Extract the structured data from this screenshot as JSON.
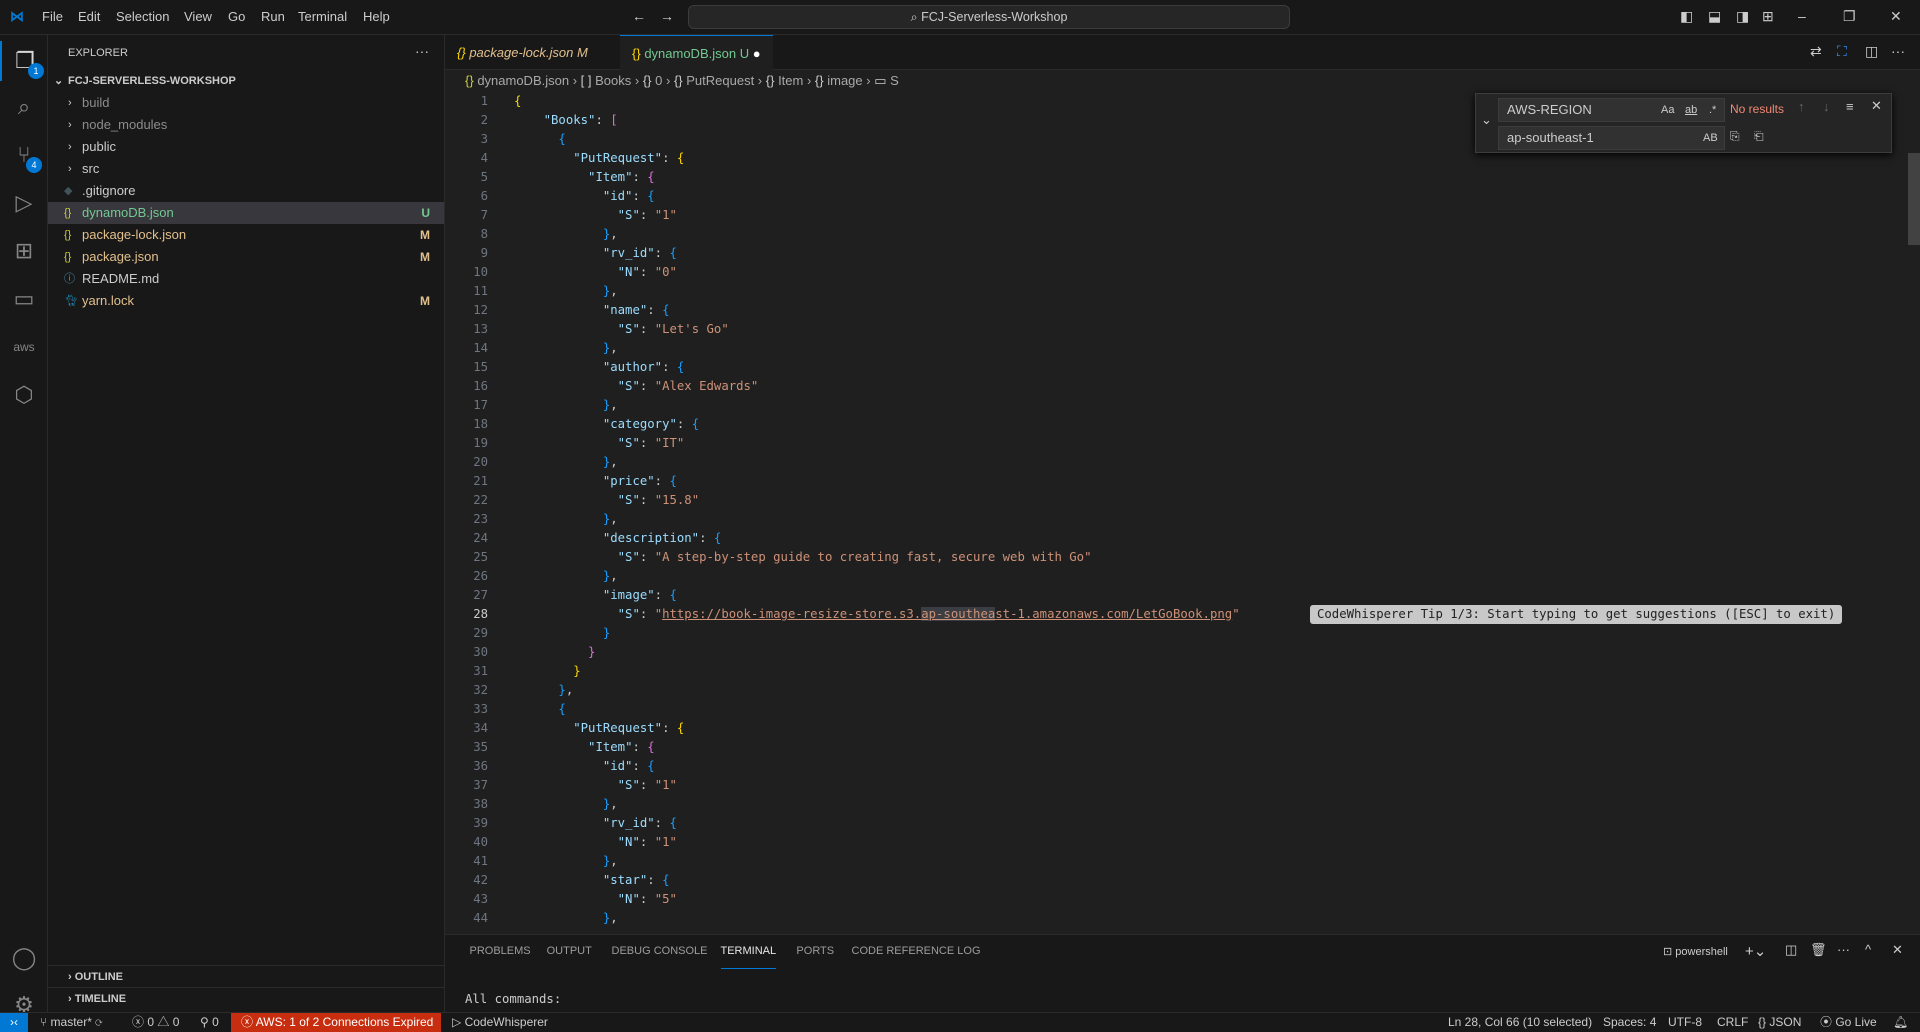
{
  "titlebar": {
    "menus": [
      "File",
      "Edit",
      "Selection",
      "View",
      "Go",
      "Run",
      "Terminal",
      "Help"
    ],
    "search": "FCJ-Serverless-Workshop"
  },
  "activity": {
    "explorer_badge": "1",
    "scm_badge": "4"
  },
  "explorer": {
    "title": "EXPLORER",
    "more": "···",
    "root": "FCJ-SERVERLESS-WORKSHOP",
    "items": [
      {
        "name": "build",
        "type": "folder",
        "status": ""
      },
      {
        "name": "node_modules",
        "type": "folder",
        "status": ""
      },
      {
        "name": "public",
        "type": "folder",
        "status": ""
      },
      {
        "name": "src",
        "type": "folder",
        "status": ""
      },
      {
        "name": ".gitignore",
        "type": "git",
        "status": ""
      },
      {
        "name": "dynamoDB.json",
        "type": "json",
        "status": "U"
      },
      {
        "name": "package-lock.json",
        "type": "json",
        "status": "M"
      },
      {
        "name": "package.json",
        "type": "json",
        "status": "M"
      },
      {
        "name": "README.md",
        "type": "info",
        "status": ""
      },
      {
        "name": "yarn.lock",
        "type": "yarn",
        "status": "M"
      }
    ],
    "outline": "OUTLINE",
    "timeline": "TIMELINE"
  },
  "tabs": [
    {
      "label": "package-lock.json",
      "status": "M"
    },
    {
      "label": "dynamoDB.json",
      "status": "U"
    }
  ],
  "breadcrumb": [
    "dynamoDB.json",
    "Books",
    "0",
    "PutRequest",
    "Item",
    "image",
    "S"
  ],
  "editor": {
    "current_line": 28,
    "selection": "ap-southea",
    "lines": [
      "{",
      "    \"Books\": [",
      "      {",
      "        \"PutRequest\": {",
      "          \"Item\": {",
      "            \"id\": {",
      "              \"S\": \"1\"",
      "            },",
      "            \"rv_id\": {",
      "              \"N\": \"0\"",
      "            },",
      "            \"name\": {",
      "              \"S\": \"Let's Go\"",
      "            },",
      "            \"author\": {",
      "              \"S\": \"Alex Edwards\"",
      "            },",
      "            \"category\": {",
      "              \"S\": \"IT\"",
      "            },",
      "            \"price\": {",
      "              \"S\": \"15.8\"",
      "            },",
      "            \"description\": {",
      "              \"S\": \"A step-by-step guide to creating fast, secure web with Go\"",
      "            },",
      "            \"image\": {",
      "              \"S\": \"https://book-image-resize-store.s3.ap-southeast-1.amazonaws.com/LetGoBook.png\"",
      "            }",
      "          }",
      "        }",
      "      },",
      "      {",
      "        \"PutRequest\": {",
      "          \"Item\": {",
      "            \"id\": {",
      "              \"S\": \"1\"",
      "            },",
      "            \"rv_id\": {",
      "              \"N\": \"1\"",
      "            },",
      "            \"star\": {",
      "              \"N\": \"5\"",
      "            },"
    ]
  },
  "find": {
    "search": "AWS-REGION",
    "replace": "ap-southeast-1",
    "result": "No results",
    "opt_case": "Aa",
    "opt_word": "ab",
    "opt_regex": ".*",
    "opt_preserve": "AB"
  },
  "tip": "CodeWhisperer Tip 1/3: Start typing to get suggestions ([ESC] to exit)",
  "panel": {
    "tabs": [
      "PROBLEMS",
      "OUTPUT",
      "DEBUG CONSOLE",
      "TERMINAL",
      "PORTS",
      "CODE REFERENCE LOG"
    ],
    "active": "TERMINAL",
    "shell": "powershell",
    "output": "All commands:"
  },
  "status": {
    "branch": "master*",
    "errors": "0",
    "warnings": "0",
    "ports": "0",
    "aws": "AWS: 1 of 2 Connections Expired",
    "codewhisperer": "CodeWhisperer",
    "position": "Ln 28, Col 66 (10 selected)",
    "spaces": "Spaces: 4",
    "encoding": "UTF-8",
    "eol": "CRLF",
    "language": "JSON",
    "golive": "Go Live"
  },
  "colors": {
    "accent": "#0078d4",
    "aws_error": "#c72e0f",
    "modified": "#e2c08d",
    "untracked": "#73c991",
    "no_results": "#f48771"
  }
}
